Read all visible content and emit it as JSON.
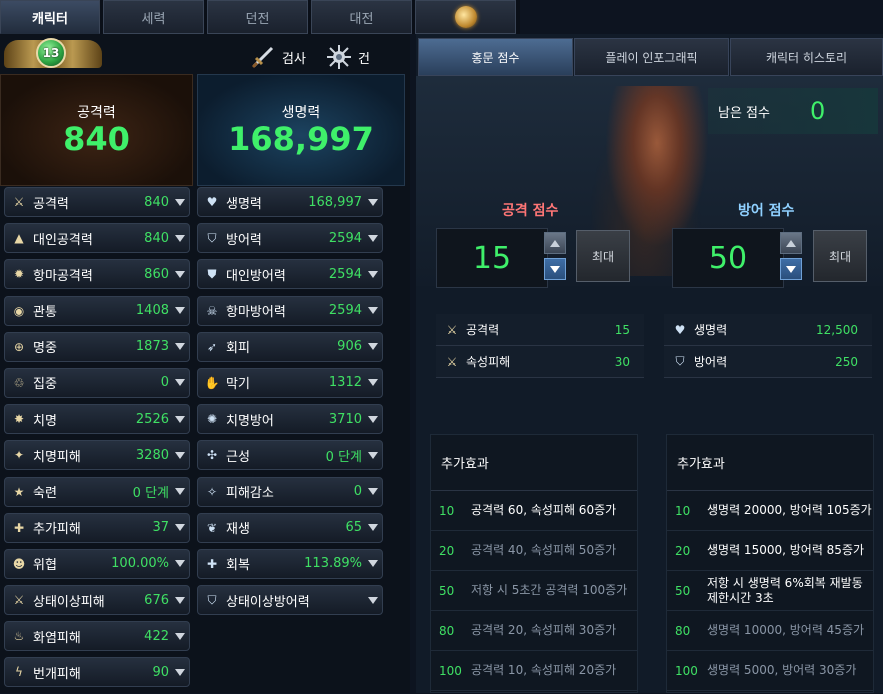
{
  "top_tabs": [
    {
      "label": "캐릭터",
      "active": true
    },
    {
      "label": "세력",
      "active": false
    },
    {
      "label": "던전",
      "active": false
    },
    {
      "label": "대전",
      "active": false
    }
  ],
  "level": "13",
  "weapons": [
    {
      "label": "검사"
    },
    {
      "label": "건"
    }
  ],
  "attack_power": {
    "label": "공격력",
    "value": "840"
  },
  "hp": {
    "label": "생명력",
    "value": "168,997"
  },
  "left_stats": [
    {
      "label": "공격력",
      "value": "840",
      "icon": "crossed-swords-icon"
    },
    {
      "label": "대인공격력",
      "value": "840",
      "icon": "pvp-sword-icon"
    },
    {
      "label": "항마공격력",
      "value": "860",
      "icon": "demon-claw-icon"
    },
    {
      "label": "관통",
      "value": "1408",
      "icon": "pierce-icon"
    },
    {
      "label": "명중",
      "value": "1873",
      "icon": "target-icon"
    },
    {
      "label": "집중",
      "value": "0",
      "icon": "focus-icon"
    },
    {
      "label": "치명",
      "value": "2526",
      "icon": "critical-icon"
    },
    {
      "label": "치명피해",
      "value": "3280",
      "icon": "critical-damage-icon"
    },
    {
      "label": "숙련",
      "value": "0 단계",
      "icon": "mastery-icon"
    },
    {
      "label": "추가피해",
      "value": "37",
      "icon": "extra-damage-icon"
    },
    {
      "label": "위협",
      "value": "100.00%",
      "icon": "threat-icon"
    },
    {
      "label": "상태이상피해",
      "value": "676",
      "icon": "debuff-damage-icon"
    },
    {
      "label": "화염피해",
      "value": "422",
      "icon": "flame-icon"
    },
    {
      "label": "번개피해",
      "value": "90",
      "icon": "lightning-icon"
    }
  ],
  "right_stats": [
    {
      "label": "생명력",
      "value": "168,997",
      "icon": "heart-icon"
    },
    {
      "label": "방어력",
      "value": "2594",
      "icon": "shield-icon"
    },
    {
      "label": "대인방어력",
      "value": "2594",
      "icon": "pvp-shield-icon"
    },
    {
      "label": "항마방어력",
      "value": "2594",
      "icon": "demon-shield-icon"
    },
    {
      "label": "회피",
      "value": "906",
      "icon": "evade-icon"
    },
    {
      "label": "막기",
      "value": "1312",
      "icon": "block-icon"
    },
    {
      "label": "치명방어",
      "value": "3710",
      "icon": "critical-defense-icon"
    },
    {
      "label": "근성",
      "value": "0 단계",
      "icon": "grit-icon"
    },
    {
      "label": "피해감소",
      "value": "0",
      "icon": "damage-reduction-icon"
    },
    {
      "label": "재생",
      "value": "65",
      "icon": "regen-icon"
    },
    {
      "label": "회복",
      "value": "113.89%",
      "icon": "recovery-icon"
    },
    {
      "label": "상태이상방어력",
      "value": "",
      "icon": "debuff-defense-icon"
    }
  ],
  "sub_tabs": [
    {
      "label": "홍문 점수",
      "active": true
    },
    {
      "label": "플레이 인포그래픽",
      "active": false
    },
    {
      "label": "캐릭터 히스토리",
      "active": false
    }
  ],
  "remaining": {
    "label": "남은 점수",
    "value": "0"
  },
  "attack_score": {
    "title": "공격 점수",
    "value": "15",
    "max_label": "최대",
    "contrib": [
      {
        "label": "공격력",
        "value": "15"
      },
      {
        "label": "속성피해",
        "value": "30"
      }
    ]
  },
  "defense_score": {
    "title": "방어 점수",
    "value": "50",
    "max_label": "최대",
    "contrib": [
      {
        "label": "생명력",
        "value": "12,500"
      },
      {
        "label": "방어력",
        "value": "250"
      }
    ]
  },
  "attack_extra": {
    "title": "추가효과",
    "rows": [
      {
        "lv": "10",
        "desc": "공격력 60, 속성피해 60증가",
        "active": true
      },
      {
        "lv": "20",
        "desc": "공격력 40, 속성피해 50증가",
        "active": false
      },
      {
        "lv": "50",
        "desc": "저항 시 5초간 공격력 100증가",
        "active": false
      },
      {
        "lv": "80",
        "desc": "공격력 20, 속성피해 30증가",
        "active": false
      },
      {
        "lv": "100",
        "desc": "공격력 10, 속성피해 20증가",
        "active": false
      }
    ]
  },
  "defense_extra": {
    "title": "추가효과",
    "rows": [
      {
        "lv": "10",
        "desc": "생명력 20000, 방어력 105증가",
        "active": true
      },
      {
        "lv": "20",
        "desc": "생명력 15000, 방어력 85증가",
        "active": true
      },
      {
        "lv": "50",
        "desc": "저항 시 생명력 6%회복 재발동 제한시간 3초",
        "active": true
      },
      {
        "lv": "80",
        "desc": "생명력 10000, 방어력 45증가",
        "active": false
      },
      {
        "lv": "100",
        "desc": "생명력 5000, 방어력 30증가",
        "active": false
      }
    ]
  }
}
